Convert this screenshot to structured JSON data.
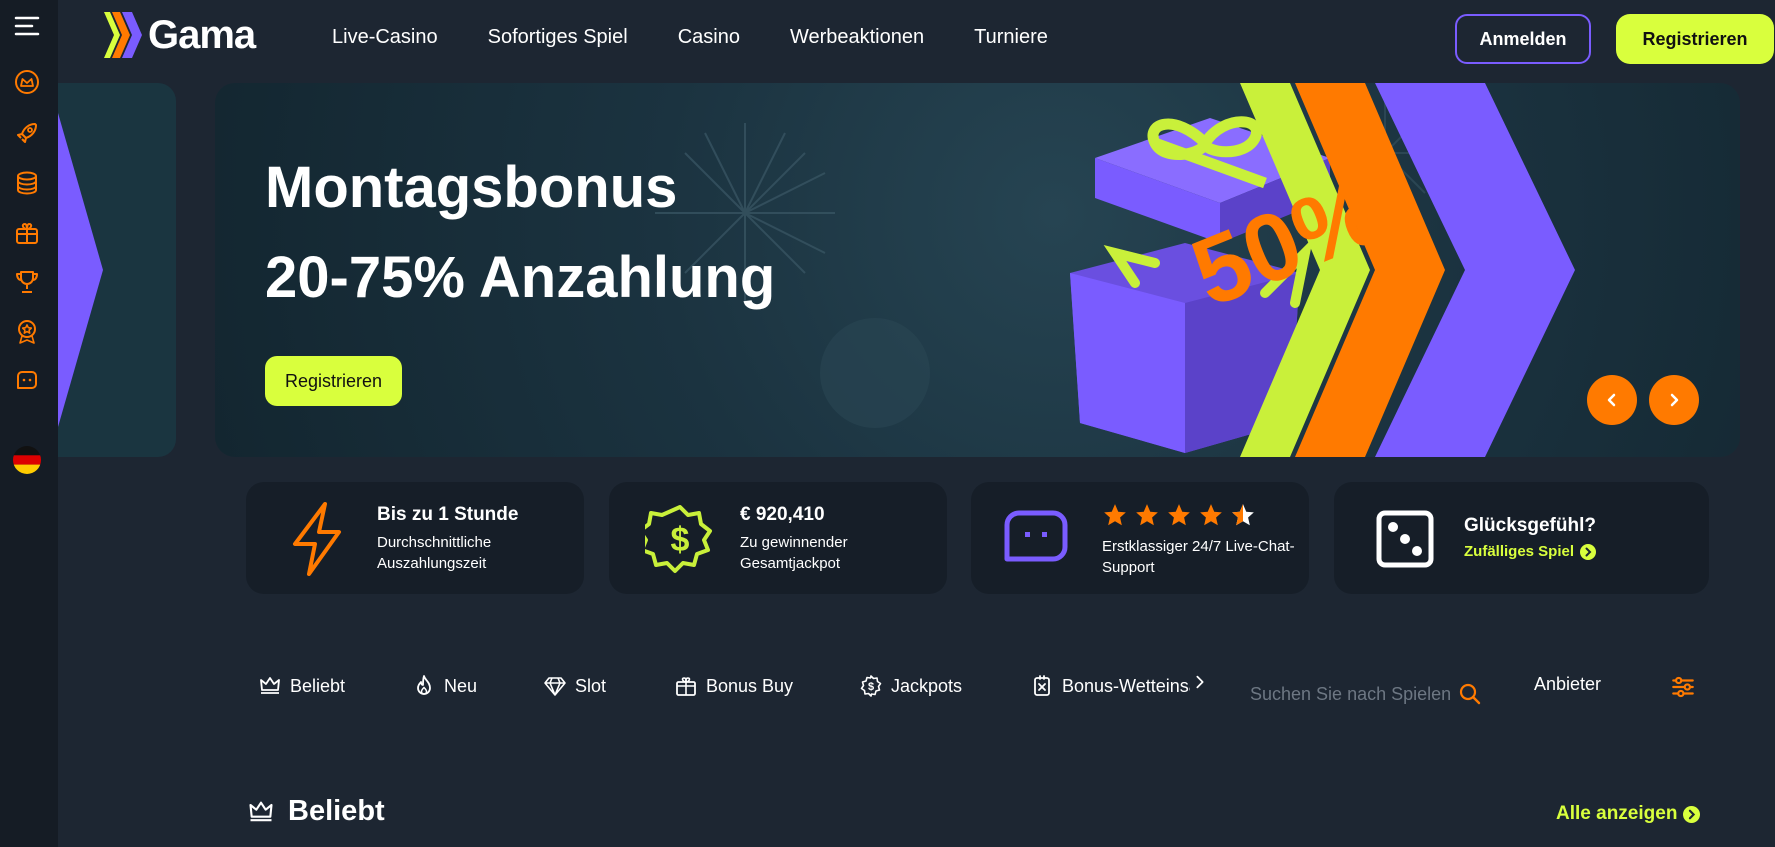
{
  "header": {
    "logo_text": "Gama",
    "nav": [
      "Live-Casino",
      "Sofortiges Spiel",
      "Casino",
      "Werbeaktionen",
      "Turniere"
    ],
    "login_label": "Anmelden",
    "register_label": "Registrieren"
  },
  "sidebar": {
    "icons": [
      "menu-icon",
      "crown-icon",
      "rocket-icon",
      "coins-icon",
      "gift-icon",
      "trophy-icon",
      "award-icon",
      "chat-icon",
      "germany-flag-icon"
    ]
  },
  "banner": {
    "title_line1": "Montagsbonus",
    "title_line2": "20-75% Anzahlung",
    "cta_label": "Registrieren",
    "graphic_text": "50%"
  },
  "features": [
    {
      "title": "Bis zu 1 Stunde",
      "subtitle": "Durchschnittliche Auszahlungszeit",
      "icon": "lightning-icon"
    },
    {
      "title": "€  920,410",
      "subtitle": "Zu gewinnender Gesamtjackpot",
      "icon": "dollar-badge-icon"
    },
    {
      "title": "",
      "subtitle": "Erstklassiger 24/7 Live-Chat-Support",
      "icon": "chat-icon",
      "rating": 4.5
    },
    {
      "title": "Glücksgefühl?",
      "link": "Zufälliges Spiel",
      "icon": "dice-icon"
    }
  ],
  "filters": {
    "tabs": [
      "Beliebt",
      "Neu",
      "Slot",
      "Bonus Buy",
      "Jackpots",
      "Bonus-Wetteinsätze"
    ],
    "search_placeholder": "Suchen Sie nach Spielen",
    "provider_label": "Anbieter"
  },
  "section": {
    "title": "Beliebt",
    "show_all": "Alle anzeigen"
  },
  "colors": {
    "accent_lime": "#d9ff3d",
    "accent_orange": "#ff7a00",
    "accent_purple": "#7a5cff",
    "background": "#1d2632"
  }
}
